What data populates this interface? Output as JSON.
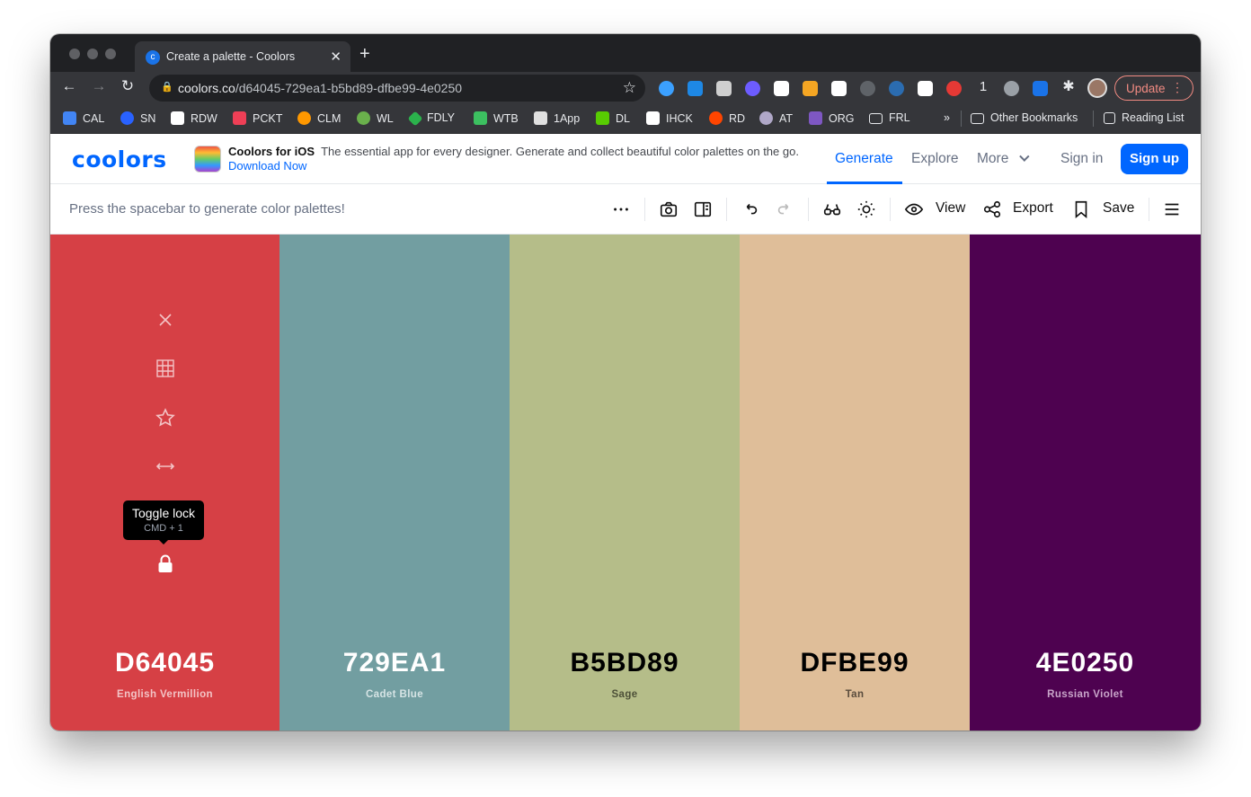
{
  "browser": {
    "tab_title": "Create a palette - Coolors",
    "url_host": "coolors.co",
    "url_path": "/d64045-729ea1-b5bd89-dfbe99-4e0250",
    "ext_badge": "1",
    "update_label": "Update",
    "bookmarks": [
      "CAL",
      "SN",
      "RDW",
      "PCKT",
      "CLM",
      "WL",
      "FDLY",
      "WTB",
      "1App",
      "DL",
      "IHCK",
      "RD",
      "AT",
      "ORG",
      "FRL"
    ],
    "overflow": "»",
    "other_bookmarks": "Other Bookmarks",
    "reading_list": "Reading List"
  },
  "site": {
    "logo": "coolors",
    "promo_title": "Coolors for iOS",
    "promo_text": "The essential app for every designer. Generate and collect beautiful color palettes on the go.",
    "promo_link": "Download Now",
    "nav": [
      "Generate",
      "Explore",
      "More"
    ],
    "sign_in": "Sign in",
    "sign_up": "Sign up"
  },
  "toolbar": {
    "hint": "Press the spacebar to generate color palettes!",
    "view": "View",
    "export": "Export",
    "save": "Save"
  },
  "tooltip": {
    "title": "Toggle lock",
    "shortcut": "CMD + 1"
  },
  "colors": [
    {
      "hex": "D64045",
      "name": "English Vermillion",
      "bg": "#d64045",
      "fg": "#ffffff",
      "sub": "#f3c4c6"
    },
    {
      "hex": "729EA1",
      "name": "Cadet Blue",
      "bg": "#729ea1",
      "fg": "#ffffff",
      "sub": "#d6e4e5"
    },
    {
      "hex": "B5BD89",
      "name": "Sage",
      "bg": "#b5bd89",
      "fg": "#000000",
      "sub": "#4d5038"
    },
    {
      "hex": "DFBE99",
      "name": "Tan",
      "bg": "#dfbe99",
      "fg": "#000000",
      "sub": "#5a4c3d"
    },
    {
      "hex": "4E0250",
      "name": "Russian Violet",
      "bg": "#4e0250",
      "fg": "#ffffff",
      "sub": "#c9a6ca"
    }
  ]
}
